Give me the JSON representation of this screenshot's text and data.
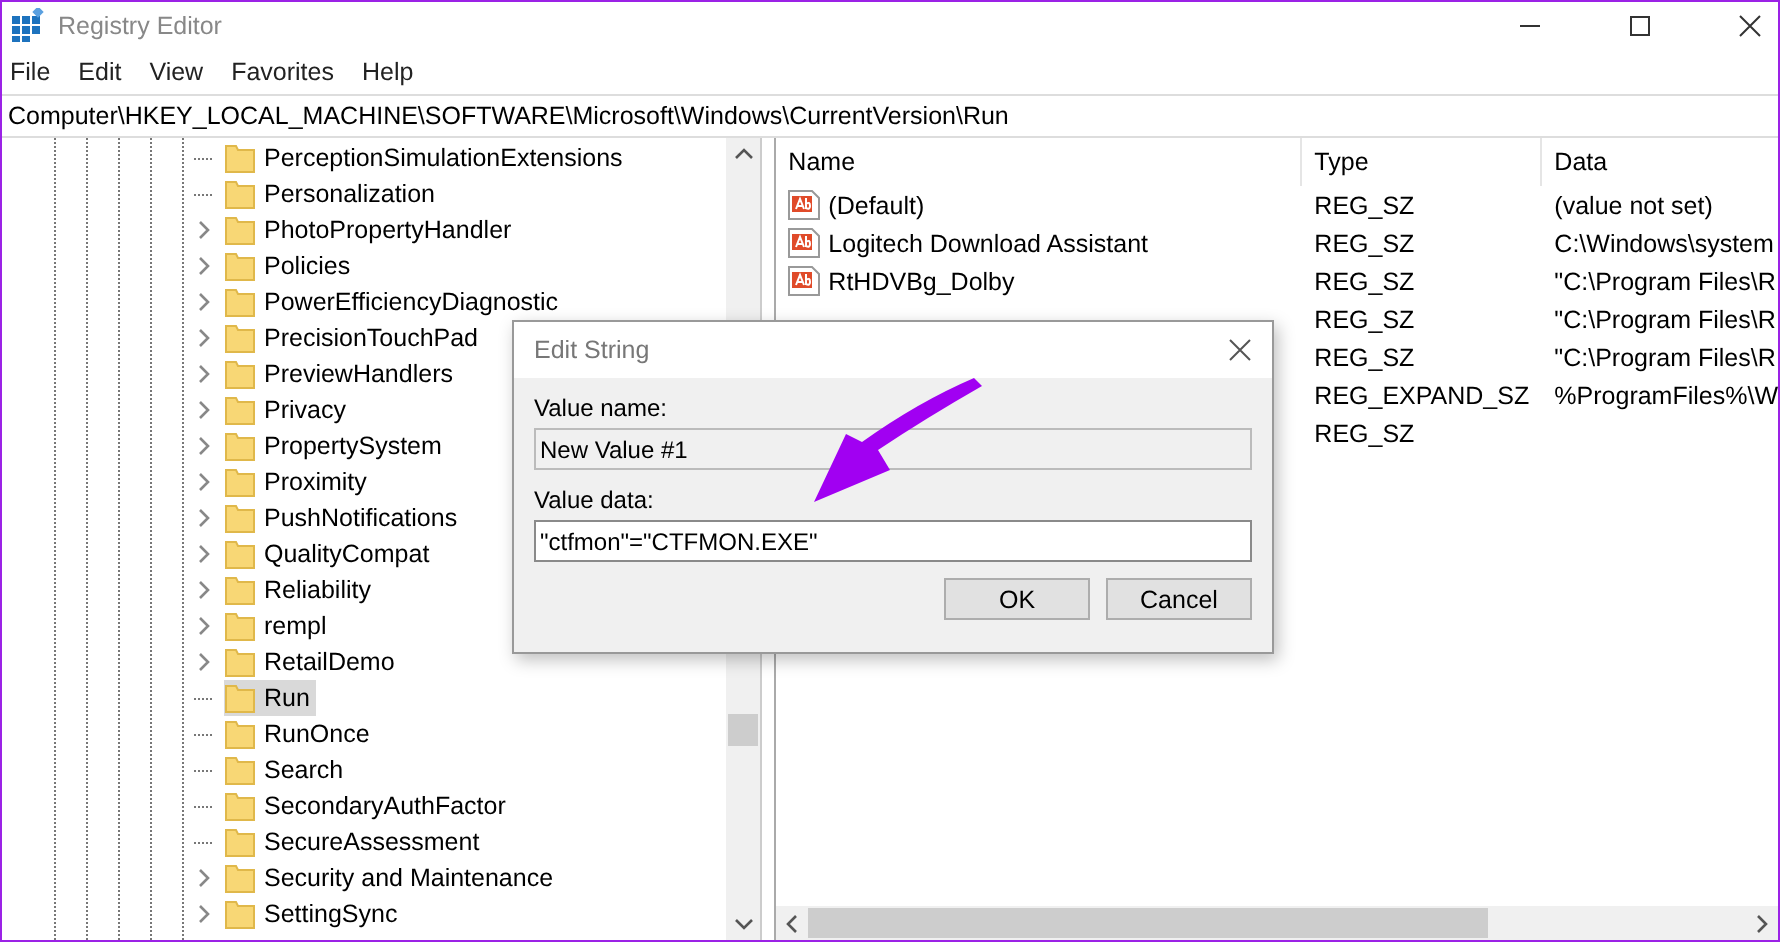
{
  "window": {
    "title": "Registry Editor"
  },
  "menu": [
    "File",
    "Edit",
    "View",
    "Favorites",
    "Help"
  ],
  "address": "Computer\\HKEY_LOCAL_MACHINE\\SOFTWARE\\Microsoft\\Windows\\CurrentVersion\\Run",
  "tree": [
    {
      "label": "PerceptionSimulationExtensions",
      "expandable": false,
      "selected": false
    },
    {
      "label": "Personalization",
      "expandable": false,
      "selected": false
    },
    {
      "label": "PhotoPropertyHandler",
      "expandable": true,
      "selected": false
    },
    {
      "label": "Policies",
      "expandable": true,
      "selected": false
    },
    {
      "label": "PowerEfficiencyDiagnostic",
      "expandable": true,
      "selected": false
    },
    {
      "label": "PrecisionTouchPad",
      "expandable": true,
      "selected": false
    },
    {
      "label": "PreviewHandlers",
      "expandable": true,
      "selected": false
    },
    {
      "label": "Privacy",
      "expandable": true,
      "selected": false
    },
    {
      "label": "PropertySystem",
      "expandable": true,
      "selected": false
    },
    {
      "label": "Proximity",
      "expandable": true,
      "selected": false
    },
    {
      "label": "PushNotifications",
      "expandable": true,
      "selected": false
    },
    {
      "label": "QualityCompat",
      "expandable": true,
      "selected": false
    },
    {
      "label": "Reliability",
      "expandable": true,
      "selected": false
    },
    {
      "label": "rempl",
      "expandable": true,
      "selected": false
    },
    {
      "label": "RetailDemo",
      "expandable": true,
      "selected": false
    },
    {
      "label": "Run",
      "expandable": false,
      "selected": true
    },
    {
      "label": "RunOnce",
      "expandable": false,
      "selected": false
    },
    {
      "label": "Search",
      "expandable": false,
      "selected": false
    },
    {
      "label": "SecondaryAuthFactor",
      "expandable": false,
      "selected": false
    },
    {
      "label": "SecureAssessment",
      "expandable": false,
      "selected": false
    },
    {
      "label": "Security and Maintenance",
      "expandable": true,
      "selected": false
    },
    {
      "label": "SettingSync",
      "expandable": true,
      "selected": false
    }
  ],
  "table": {
    "columns": [
      "Name",
      "Type",
      "Data"
    ],
    "rows": [
      {
        "name": "(Default)",
        "type": "REG_SZ",
        "data": "(value not set)"
      },
      {
        "name": "Logitech Download Assistant",
        "type": "REG_SZ",
        "data": "C:\\Windows\\system"
      },
      {
        "name": "RtHDVBg_Dolby",
        "type": "REG_SZ",
        "data": "\"C:\\Program Files\\R"
      },
      {
        "type": "REG_SZ",
        "data": "\"C:\\Program Files\\R"
      },
      {
        "type": "REG_SZ",
        "data": "\"C:\\Program Files\\R"
      },
      {
        "type": "REG_EXPAND_SZ",
        "data": "%ProgramFiles%\\W"
      },
      {
        "type": "REG_SZ"
      }
    ]
  },
  "dialog": {
    "title": "Edit String",
    "name_label": "Value name:",
    "name_value": "New Value #1",
    "data_label": "Value data:",
    "data_value": "\"ctfmon\"=\"CTFMON.EXE\"",
    "buttons": [
      "OK",
      "Cancel"
    ]
  }
}
